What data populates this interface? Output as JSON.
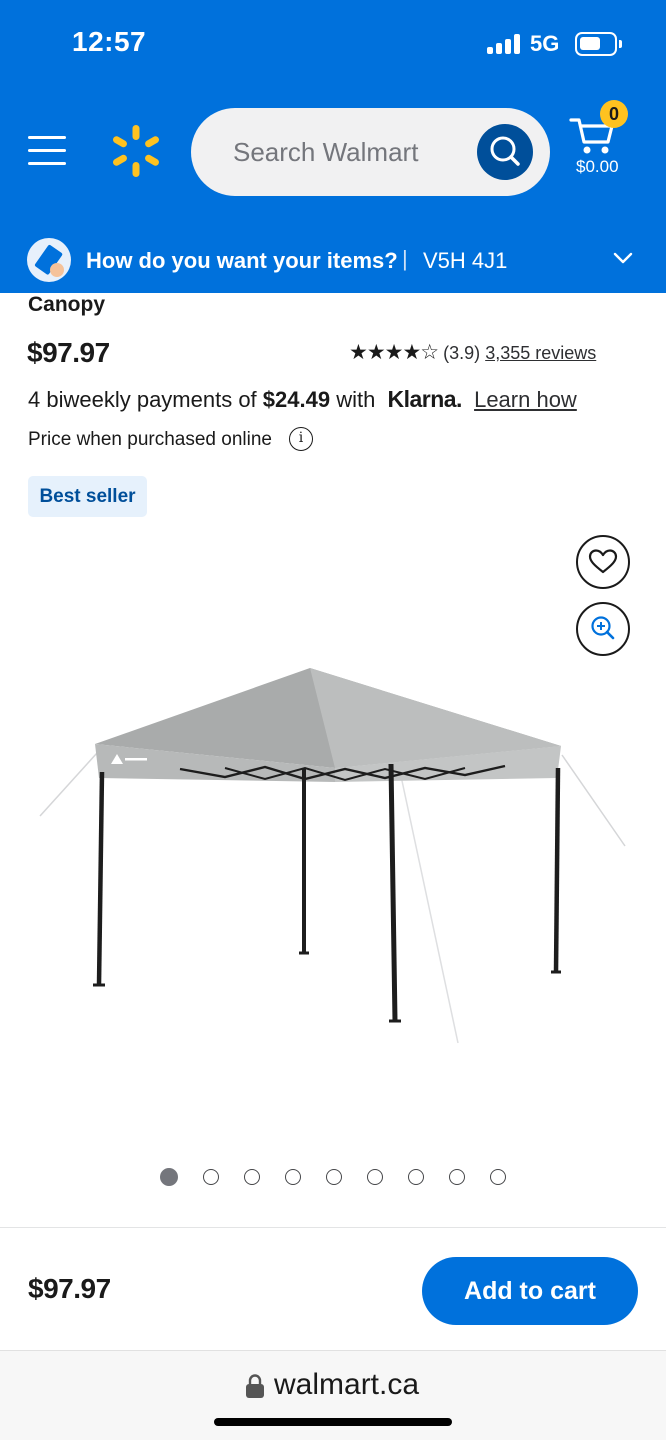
{
  "status_bar": {
    "time": "12:57",
    "network": "5G"
  },
  "header": {
    "search": {
      "placeholder": "Search Walmart"
    },
    "cart": {
      "count": "0",
      "total": "$0.00"
    },
    "icons": [
      "menu-icon",
      "walmart-spark-logo",
      "search-icon",
      "cart-icon"
    ]
  },
  "delivery": {
    "question": "How do you want your items?",
    "separator": "|",
    "postal_code": "V5H 4J1"
  },
  "product": {
    "title_fragment": "Canopy",
    "price": "$97.97",
    "rating": {
      "stars": "★★★★☆",
      "value_text": "(3.9)",
      "reviews_text": "3,355 reviews"
    },
    "klarna": {
      "prefix": "4 biweekly payments of",
      "amount": "$24.49",
      "middle": "with",
      "brand": "Klarna.",
      "learn_label": "Learn how"
    },
    "online_note": "Price when purchased online",
    "info_glyph": "i",
    "badge": "Best seller",
    "image_count": 9,
    "active_image": 1
  },
  "footer": {
    "price": "$97.97",
    "add_to_cart": "Add to cart"
  },
  "browser": {
    "domain": "walmart.ca"
  },
  "colors": {
    "brand_blue": "#0071dc",
    "dark_blue": "#004f9a",
    "spark_yellow": "#ffc220",
    "badge_bg": "#e6f1fc"
  }
}
